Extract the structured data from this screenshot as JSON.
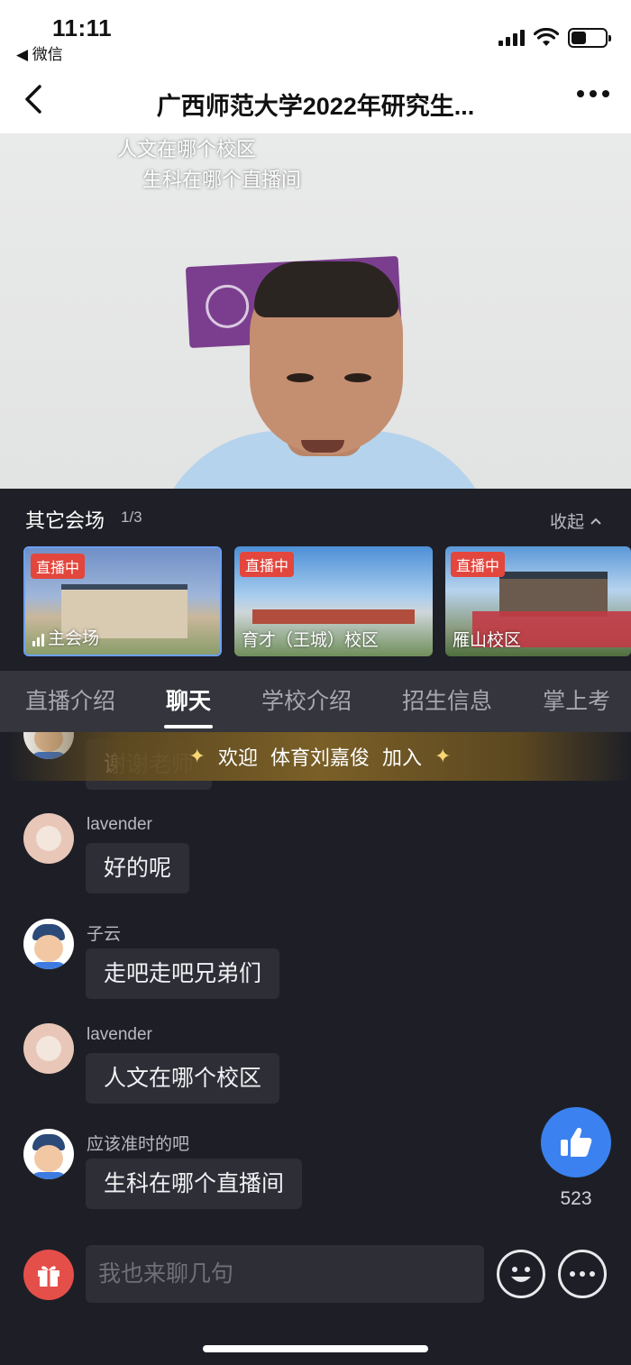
{
  "status_bar": {
    "time": "11:11",
    "back_app": "◀ 微信"
  },
  "nav": {
    "title": "广西师范大学2022年研究生..."
  },
  "video": {
    "danmaku": [
      "人文在哪个校区",
      "生科在哪个直播间"
    ]
  },
  "venues": {
    "title": "其它会场",
    "count": "1/3",
    "collapse_label": "收起",
    "items": [
      {
        "live_badge": "直播中",
        "name": "主会场"
      },
      {
        "live_badge": "直播中",
        "name": "育才（王城）校区"
      },
      {
        "live_badge": "直播中",
        "name": "雁山校区"
      }
    ]
  },
  "tabs": [
    "直播介绍",
    "聊天",
    "学校介绍",
    "招生信息",
    "掌上考"
  ],
  "active_tab": "聊天",
  "welcome": {
    "prefix": "欢迎",
    "user": "体育刘嘉俊",
    "suffix": "加入"
  },
  "chat": {
    "partial_message": "谢谢老师",
    "messages": [
      {
        "user": "lavender",
        "text": "好的呢",
        "avatar": "cat-avatar"
      },
      {
        "user": "子云",
        "text": "走吧走吧兄弟们",
        "avatar": "boy-avatar"
      },
      {
        "user": "lavender",
        "text": "人文在哪个校区",
        "avatar": "cat-avatar"
      },
      {
        "user": "应该准时的吧",
        "text": "生科在哪个直播间",
        "avatar": "boy-avatar"
      }
    ]
  },
  "like": {
    "count": "523"
  },
  "composer": {
    "placeholder": "我也来聊几句"
  },
  "colors": {
    "accent": "#3b82f0",
    "live_badge": "#e2463d",
    "gift": "#e54f4a",
    "background": "#1e1f26"
  }
}
